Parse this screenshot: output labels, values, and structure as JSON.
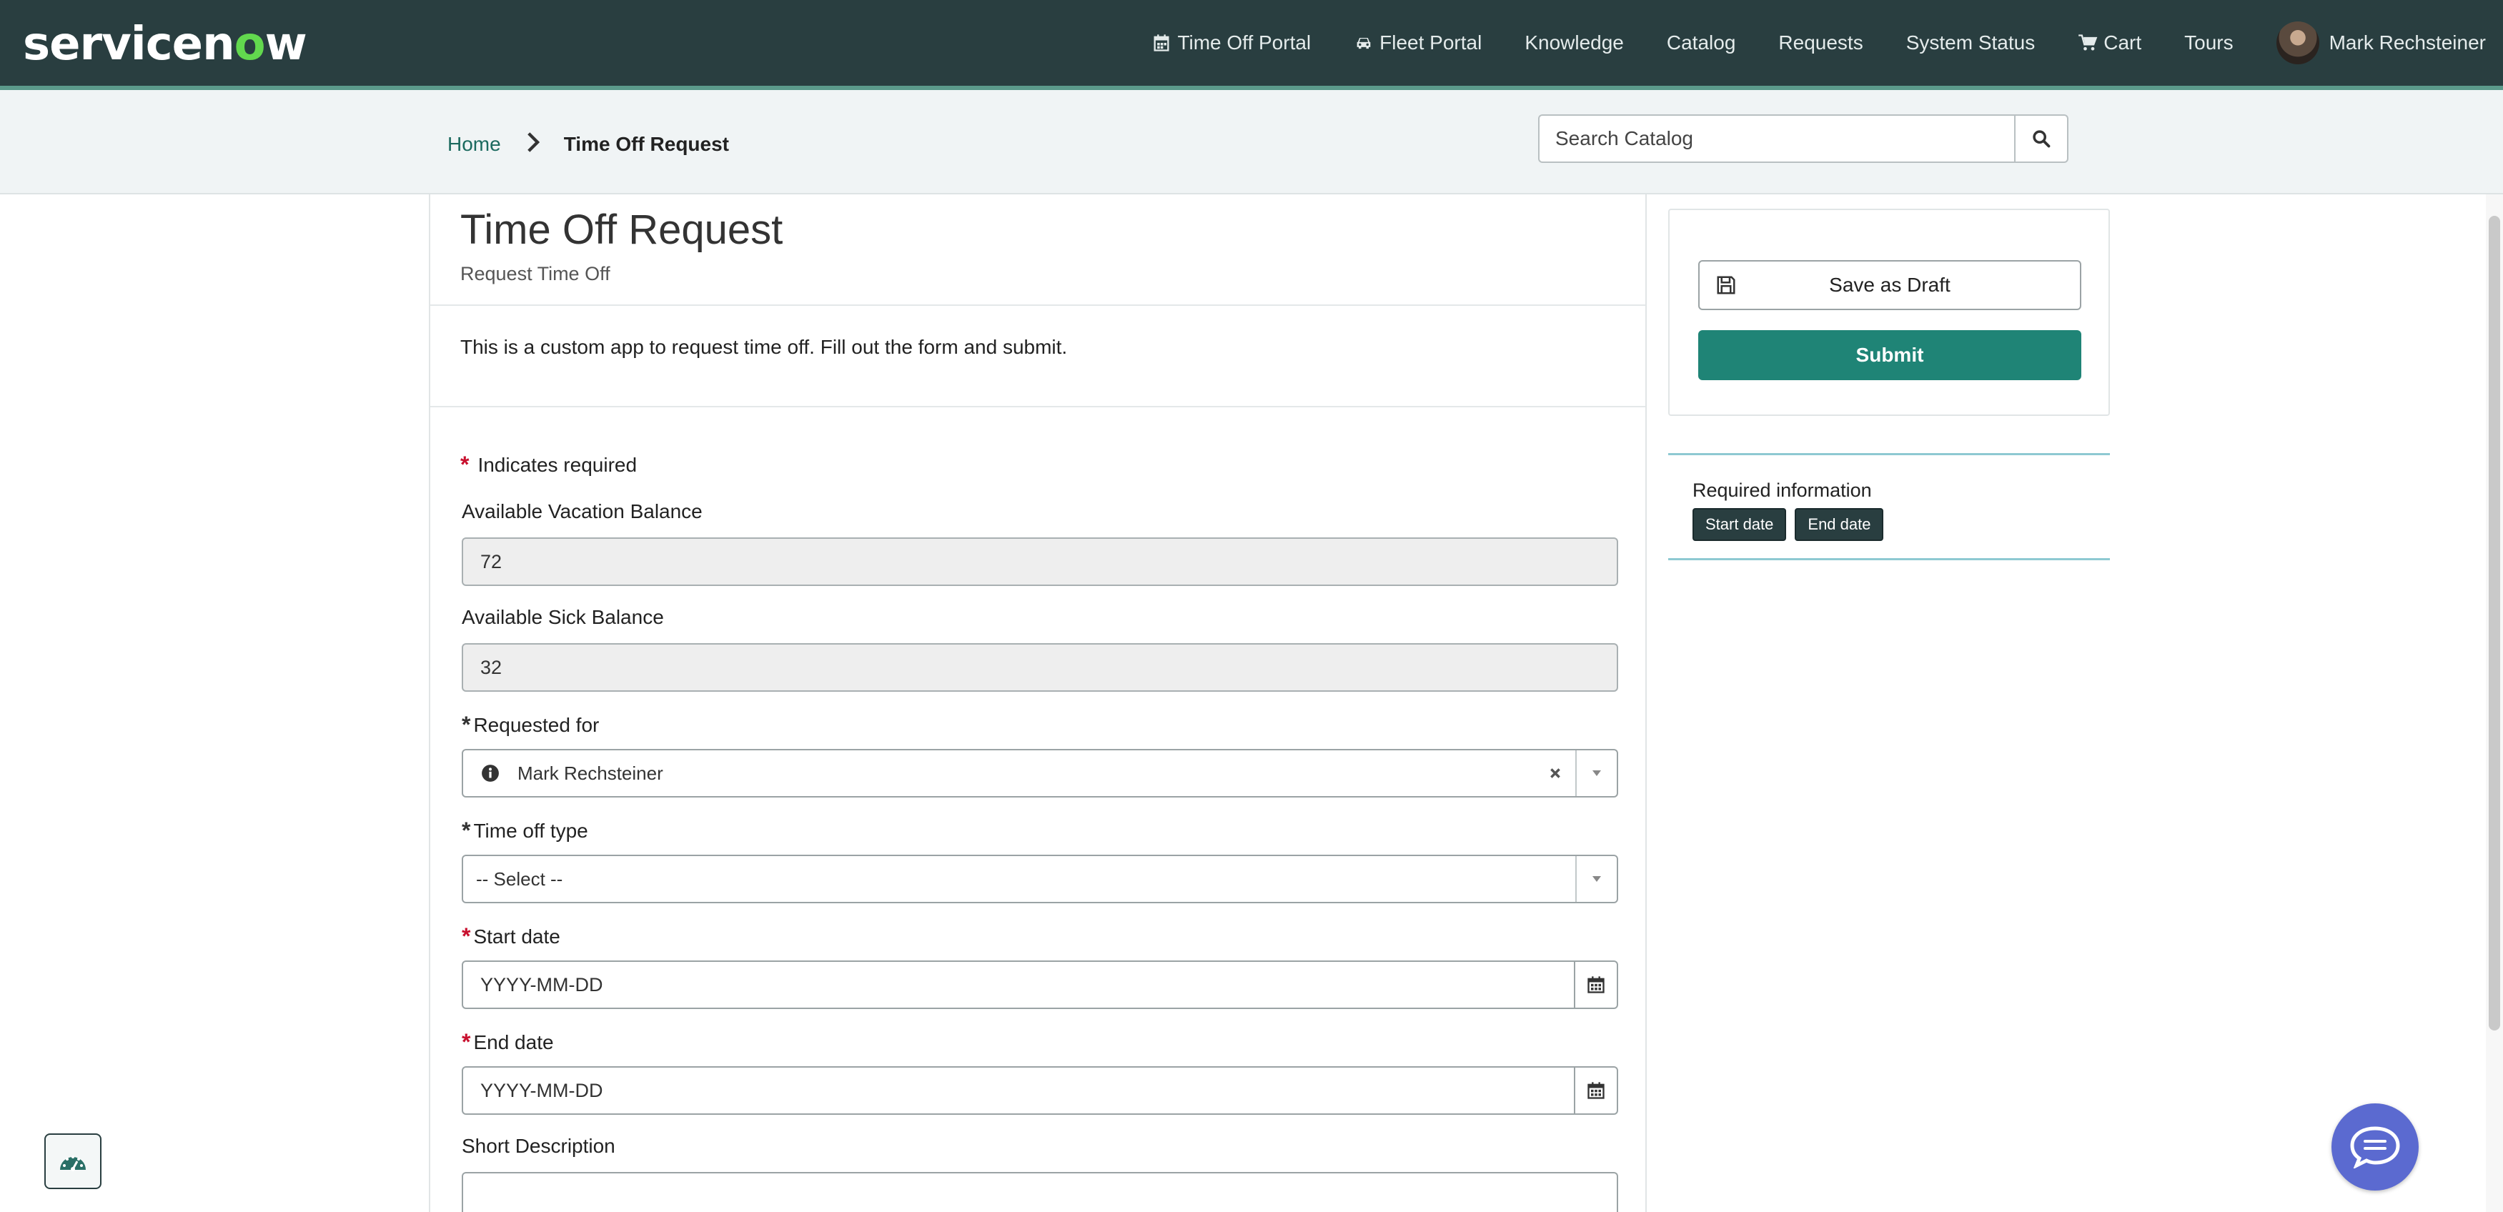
{
  "brand": {
    "name_prefix": "servicen",
    "name_o": "o",
    "name_suffix": "w"
  },
  "nav": {
    "items": [
      {
        "label": "Time Off Portal",
        "icon": "calendar-icon"
      },
      {
        "label": "Fleet Portal",
        "icon": "car-icon"
      },
      {
        "label": "Knowledge"
      },
      {
        "label": "Catalog"
      },
      {
        "label": "Requests"
      },
      {
        "label": "System Status"
      },
      {
        "label": "Cart",
        "icon": "cart-icon"
      },
      {
        "label": "Tours"
      }
    ],
    "user": {
      "name": "Mark Rechsteiner"
    }
  },
  "breadcrumb": {
    "home": "Home",
    "current": "Time Off Request"
  },
  "search": {
    "placeholder": "Search Catalog"
  },
  "form": {
    "title": "Time Off Request",
    "subtitle": "Request Time Off",
    "intro": "This is a custom app to request time off. Fill out the form and submit.",
    "required_note": "Indicates required",
    "required_marker": "*",
    "fields": {
      "vacation": {
        "label": "Available Vacation Balance",
        "value": "72"
      },
      "sick": {
        "label": "Available Sick Balance",
        "value": "32"
      },
      "requested_for": {
        "label": "Requested for",
        "value": "Mark Rechsteiner"
      },
      "time_off_type": {
        "label": "Time off type",
        "value": "-- Select --"
      },
      "start_date": {
        "label": "Start date",
        "placeholder": "YYYY-MM-DD"
      },
      "end_date": {
        "label": "End date",
        "placeholder": "YYYY-MM-DD"
      },
      "short_description": {
        "label": "Short Description",
        "value": ""
      }
    }
  },
  "actions": {
    "save_draft": "Save as Draft",
    "submit": "Submit"
  },
  "required_info": {
    "title": "Required information",
    "tags": [
      "Start date",
      "End date"
    ]
  },
  "colors": {
    "nav_bg": "#293e40",
    "accent": "#62d84e",
    "submit": "#1f8476",
    "required": "#c8102e",
    "chat": "#5b6ad0"
  }
}
